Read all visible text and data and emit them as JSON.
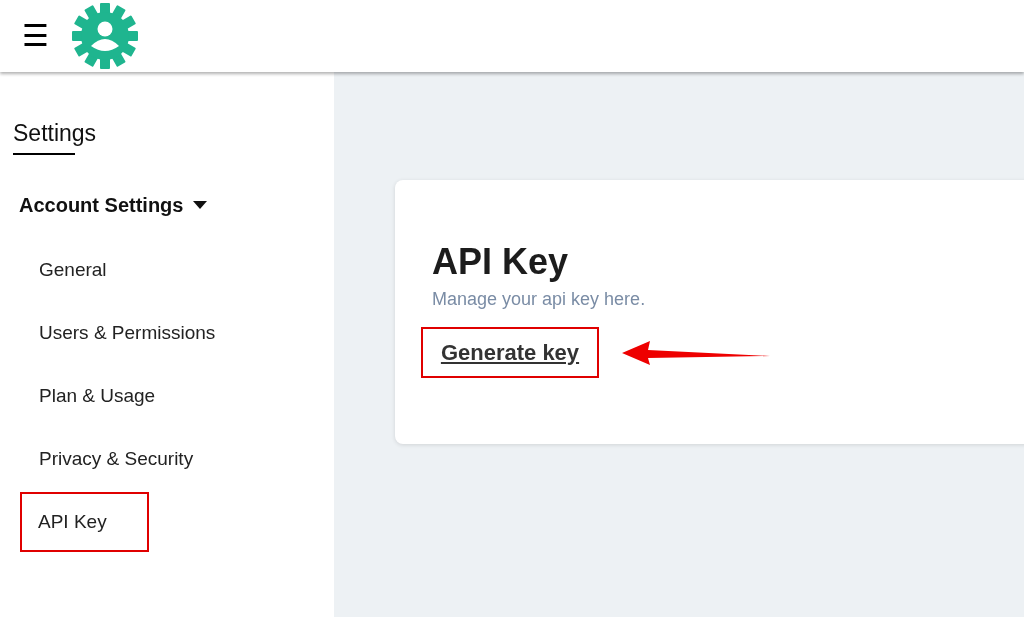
{
  "header": {
    "menu_icon": "☰"
  },
  "sidebar": {
    "title": "Settings",
    "section": {
      "label": "Account Settings",
      "expanded": true
    },
    "items": [
      {
        "label": "General",
        "annotated": false
      },
      {
        "label": "Users & Permissions",
        "annotated": false
      },
      {
        "label": "Plan & Usage",
        "annotated": false
      },
      {
        "label": "Privacy & Security",
        "annotated": false
      },
      {
        "label": "API Key",
        "annotated": true
      }
    ]
  },
  "card": {
    "title": "API Key",
    "subtitle": "Manage your api key here.",
    "action": {
      "label": "Generate key",
      "annotated": true
    }
  }
}
